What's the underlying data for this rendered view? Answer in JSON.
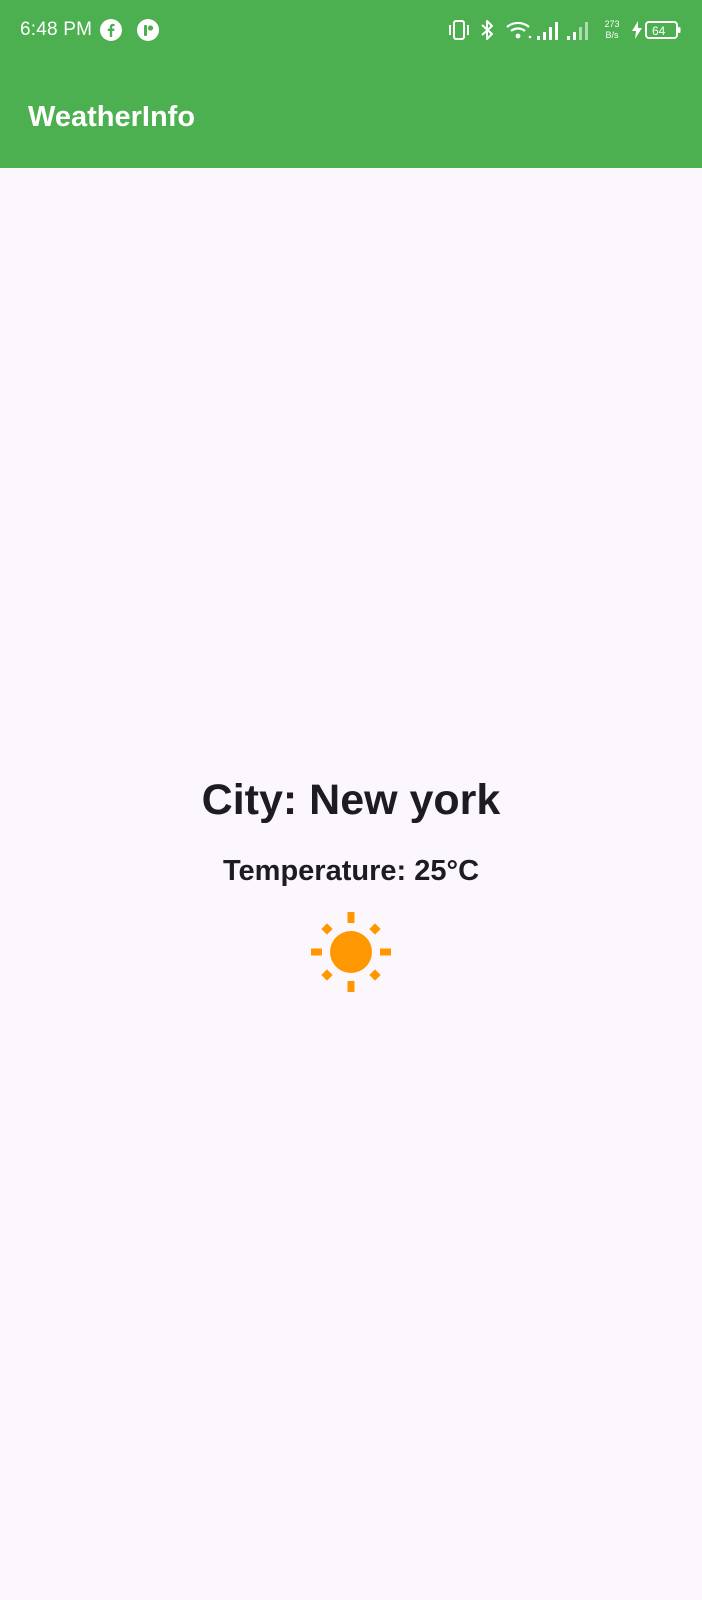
{
  "status_bar": {
    "time": "6:48 PM",
    "net_speed_value": "273",
    "net_speed_unit": "B/s",
    "battery": "64",
    "icons": [
      "facebook-icon",
      "app-notification-icon",
      "vibrate-icon",
      "bluetooth-icon",
      "wifi-icon",
      "signal-icon",
      "signal-icon",
      "charging-icon",
      "battery-icon"
    ]
  },
  "app_bar": {
    "title": "WeatherInfo",
    "color": "#4caf50"
  },
  "weather": {
    "city_text": "City: New york",
    "temperature_text": "Temperature: 25°C",
    "icon": "sun-icon",
    "icon_color": "#ff9800"
  },
  "colors": {
    "background": "#fcf6fd",
    "text": "#1e1b22"
  }
}
